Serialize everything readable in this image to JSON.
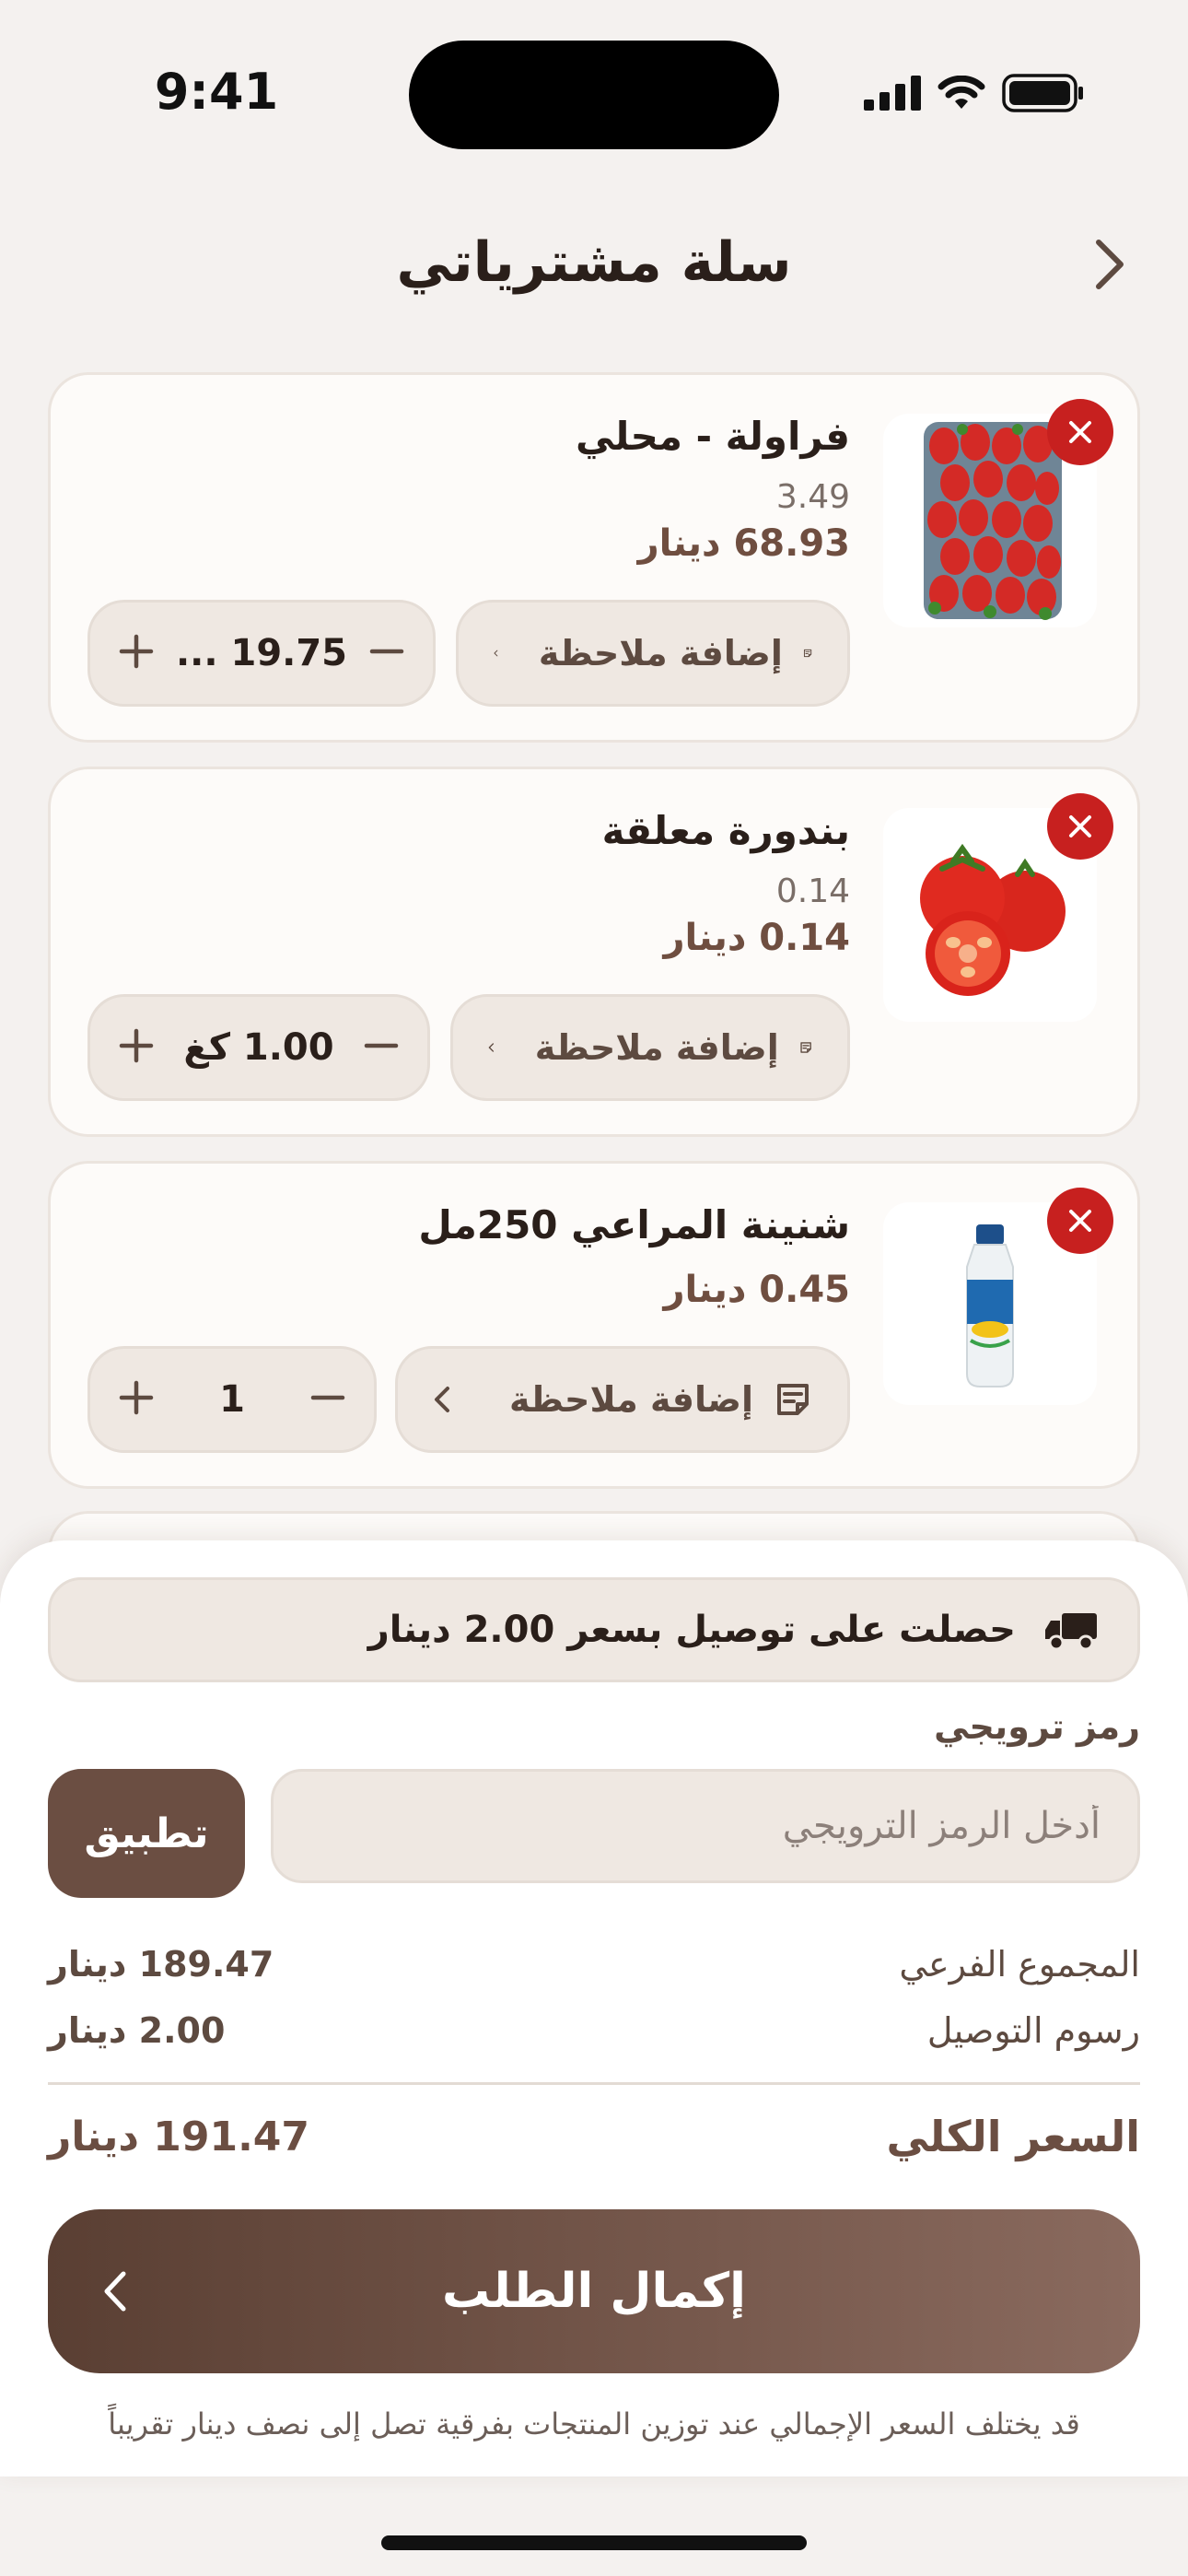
{
  "status_bar": {
    "time": "9:41"
  },
  "header": {
    "title": "سلة مشترياتي",
    "back_icon": "chevron-right-icon"
  },
  "cart_items": [
    {
      "name": "فراولة - محلي",
      "unit_price": "3.49",
      "line_total": "68.93 دينار",
      "note_label": "إضافة ملاحظة",
      "quantity": "19.75 ...",
      "image": "strawberries"
    },
    {
      "name": "بندورة معلقة",
      "unit_price": "0.14",
      "line_total": "0.14 دينار",
      "note_label": "إضافة ملاحظة",
      "quantity": "1.00 كغ",
      "image": "tomatoes"
    },
    {
      "name": "شنينة المراعي 250مل",
      "line_total": "0.45 دينار",
      "note_label": "إضافة ملاحظة",
      "quantity": "1",
      "image": "laban-bottle"
    }
  ],
  "delivery_banner": {
    "text": "حصلت على توصيل بسعر 2.00 دينار",
    "icon": "truck-icon"
  },
  "promo": {
    "label": "رمز ترويجي",
    "placeholder": "أدخل الرمز الترويجي",
    "apply_label": "تطبيق"
  },
  "summary": {
    "subtotal_label": "المجموع الفرعي",
    "subtotal_value": "189.47 دينار",
    "delivery_label": "رسوم التوصيل",
    "delivery_value": "2.00 دينار",
    "total_label": "السعر الكلي",
    "total_value": "191.47 دينار"
  },
  "checkout": {
    "label": "إكمال الطلب"
  },
  "disclaimer": "قد يختلف السعر الإجمالي عند توزين المنتجات بفرقية تصل إلى نصف دينار تقريباً",
  "colors": {
    "accent": "#6b4e42",
    "remove": "#c7201f",
    "background": "#f4f1ef"
  }
}
